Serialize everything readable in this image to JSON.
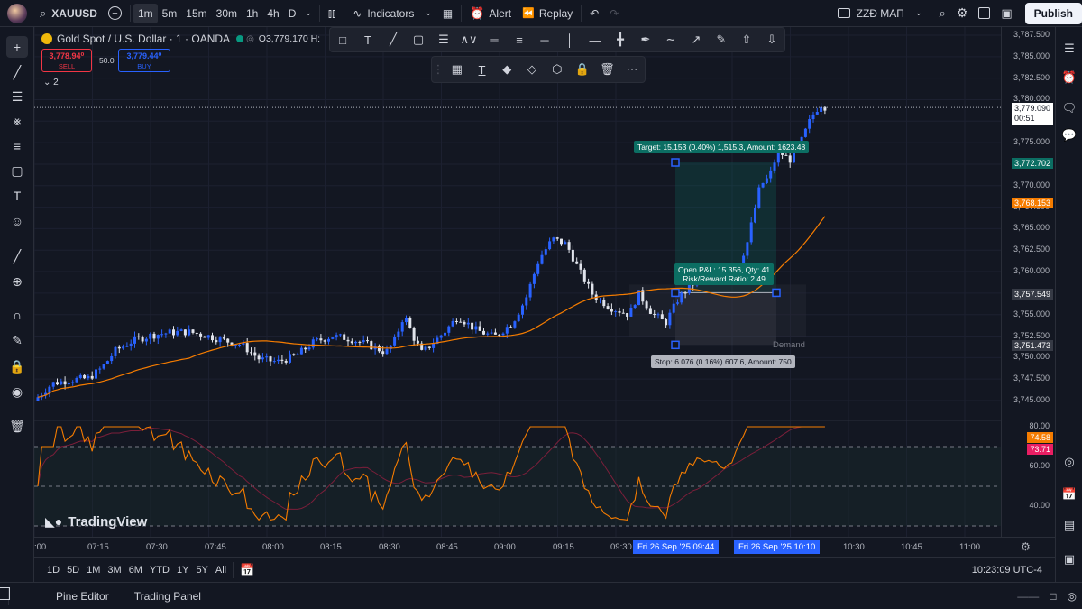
{
  "topbar": {
    "symbol": "XAUUSD",
    "timeframes": [
      "1m",
      "5m",
      "15m",
      "30m",
      "1h",
      "4h",
      "D"
    ],
    "active_timeframe": "1m",
    "indicators_label": "Indicators",
    "alert_label": "Alert",
    "replay_label": "Replay",
    "layout_name": "ZZĐ MAΠ",
    "publish_label": "Publish"
  },
  "legend": {
    "title": "Gold Spot / U.S. Dollar · 1 · OANDA",
    "ohlc": "O3,779.170 H:",
    "sell_price": "3,778.94⁰",
    "sell_label": "SELL",
    "spread": "50.0",
    "buy_price": "3,779.44⁰",
    "buy_label": "BUY",
    "collapse_count": "2"
  },
  "price_axis": {
    "ticks": [
      "3,787.500",
      "3,785.000",
      "3,782.500",
      "3,780.000",
      "3,777.500",
      "3,775.000",
      "3,772.500",
      "3,770.000",
      "3,767.500",
      "3,765.000",
      "3,762.500",
      "3,760.000",
      "3,757.500",
      "3,755.000",
      "3,752.500",
      "3,750.000",
      "3,747.500",
      "3,745.000"
    ],
    "current_price": "3,779.090",
    "countdown": "00:51",
    "target_price": "3,772.702",
    "ma_price": "3,768.153",
    "entry_price": "3,757.549",
    "stop_price": "3,751.473",
    "colors": {
      "current": "#ffffff",
      "target": "#0c6e63",
      "ma": "#f57c00",
      "entry": "#363a45",
      "stop": "#363a45"
    }
  },
  "rsi_axis": {
    "ticks": [
      "80.00",
      "60.00",
      "40.00"
    ],
    "value1": "74.58",
    "value2": "73.71",
    "colors": {
      "value1": "#f57c00",
      "value2": "#e91e63"
    }
  },
  "time_axis": {
    "ticks": [
      ":00",
      "07:15",
      "07:30",
      "07:45",
      "08:00",
      "08:15",
      "08:30",
      "08:45",
      "09:00",
      "09:15",
      "09:30",
      "10:30",
      "10:45",
      "11:00"
    ],
    "badge_start": "Fri 26 Sep '25   09:44",
    "badge_end": "Fri 26 Sep '25   10:10"
  },
  "position": {
    "target_label": "Target: 15.153 (0.40%) 1,515.3, Amount: 1623.48",
    "pnl_label": "Open P&L: 15.356, Qty: 41",
    "rr_label": "Risk/Reward Ratio: 2.49",
    "stop_label": "Stop: 6.076 (0.16%) 607.6, Amount: 750",
    "demand_label": "Demand"
  },
  "watermark": "TradingView",
  "ranges": [
    "1D",
    "5D",
    "1M",
    "3M",
    "6M",
    "YTD",
    "1Y",
    "5Y",
    "All"
  ],
  "clock": "10:23:09 UTC-4",
  "bottom_tabs": [
    "Pine Editor",
    "Trading Panel"
  ]
}
